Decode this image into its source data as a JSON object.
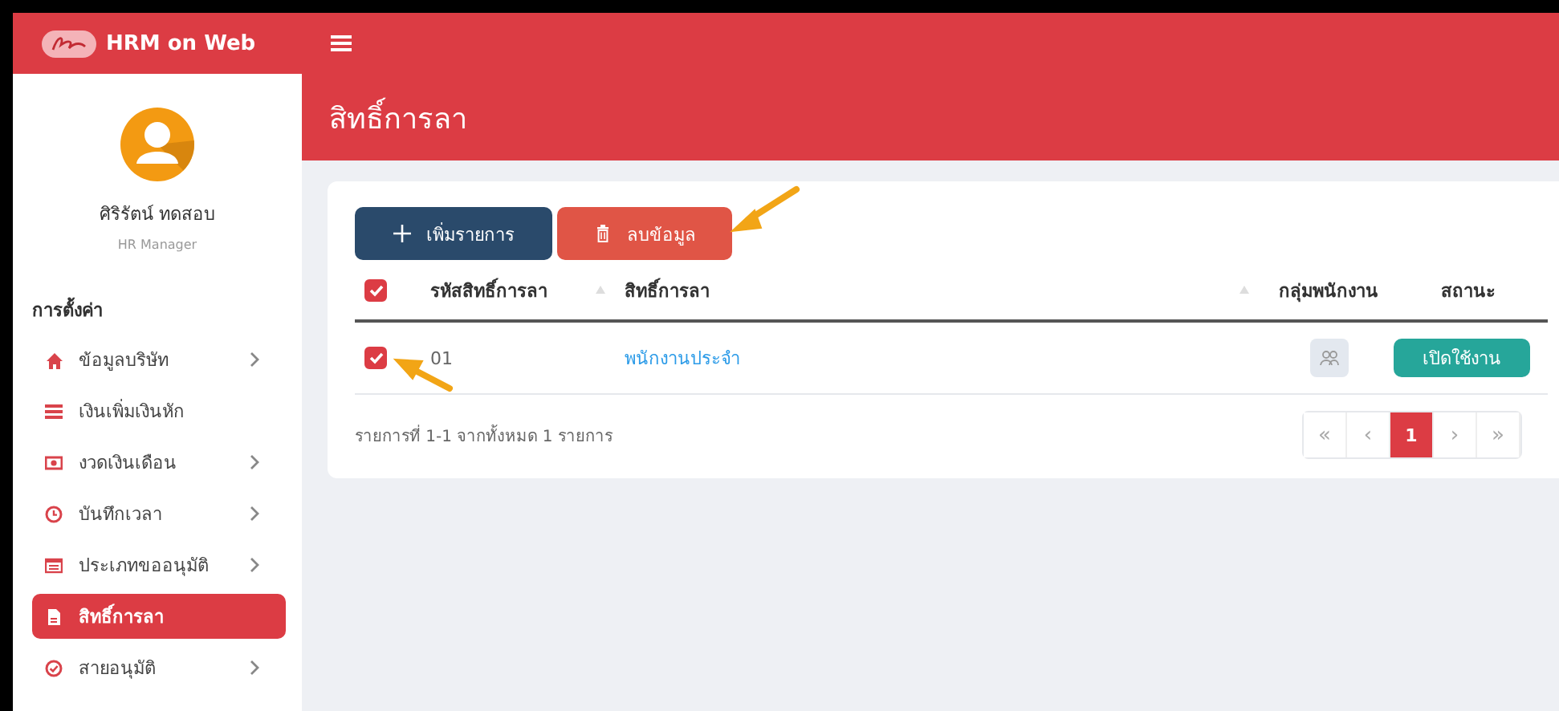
{
  "brand": "HRM on Web",
  "user": {
    "name": "ศิริรัตน์ ทดสอบ",
    "role": "HR Manager"
  },
  "sidebar": {
    "section": "การตั้งค่า",
    "items": [
      {
        "label": "ข้อมูลบริษัท",
        "has_submenu": true,
        "selected": false
      },
      {
        "label": "เงินเพิ่มเงินหัก",
        "has_submenu": false,
        "selected": false
      },
      {
        "label": "งวดเงินเดือน",
        "has_submenu": true,
        "selected": false
      },
      {
        "label": "บันทึกเวลา",
        "has_submenu": true,
        "selected": false
      },
      {
        "label": "ประเภทขออนุมัติ",
        "has_submenu": true,
        "selected": false
      },
      {
        "label": "สิทธิ์การลา",
        "has_submenu": false,
        "selected": true
      },
      {
        "label": "สายอนุมัติ",
        "has_submenu": true,
        "selected": false
      }
    ]
  },
  "page_title": "สิทธิ์การลา",
  "toolbar": {
    "buttons": [
      {
        "label": "เพิ่มรายการ",
        "kind": "add"
      },
      {
        "label": "ลบข้อมูล",
        "kind": "delete"
      }
    ]
  },
  "table": {
    "select_all": true,
    "columns": [
      {
        "label": "รหัสสิทธิ์การลา",
        "sortable": true
      },
      {
        "label": "สิทธิ์การลา",
        "sortable": true
      },
      {
        "label": "กลุ่มพนักงาน",
        "sortable": false
      },
      {
        "label": "สถานะ",
        "sortable": false
      }
    ],
    "rows": [
      {
        "checked": true,
        "code": "01",
        "name": "พนักงานประจำ",
        "status": "เปิดใช้งาน"
      }
    ]
  },
  "footer": "รายการที่ 1-1 จากทั้งหมด 1 รายการ",
  "pagination": [
    {
      "label": "«",
      "selected": false
    },
    {
      "label": "‹",
      "selected": false
    },
    {
      "label": "1",
      "selected": true
    },
    {
      "label": "›",
      "selected": false
    },
    {
      "label": "»",
      "selected": false
    }
  ]
}
